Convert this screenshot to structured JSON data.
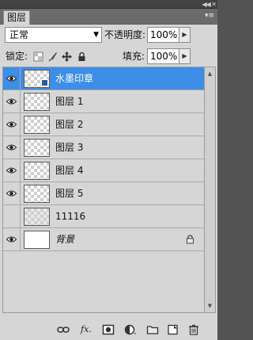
{
  "panel": {
    "tab_label": "图层",
    "blend_mode": "正常",
    "opacity_label": "不透明度:",
    "opacity_value": "100%",
    "lock_label": "锁定:",
    "fill_label": "填充:",
    "fill_value": "100%"
  },
  "layers": [
    {
      "name": "水墨印章",
      "visible": true,
      "selected": true,
      "thumb": "checker-linked"
    },
    {
      "name": "图层 1",
      "visible": true,
      "selected": false,
      "thumb": "checker"
    },
    {
      "name": "图层 2",
      "visible": true,
      "selected": false,
      "thumb": "checker"
    },
    {
      "name": "图层 3",
      "visible": true,
      "selected": false,
      "thumb": "checker"
    },
    {
      "name": "图层 4",
      "visible": true,
      "selected": false,
      "thumb": "checker"
    },
    {
      "name": "图层 5",
      "visible": true,
      "selected": false,
      "thumb": "checker"
    },
    {
      "name": "11116",
      "visible": false,
      "selected": false,
      "thumb": "stamp"
    },
    {
      "name": "背景",
      "visible": true,
      "selected": false,
      "thumb": "white",
      "locked": true,
      "italic": true
    }
  ],
  "bottom_icons": [
    "link-icon",
    "fx-icon",
    "mask-icon",
    "adjustment-icon",
    "folder-icon",
    "new-layer-icon",
    "trash-icon"
  ],
  "colors": {
    "selected": "#3d8ee6",
    "panel": "#d6d6d6",
    "frame": "#535353"
  }
}
